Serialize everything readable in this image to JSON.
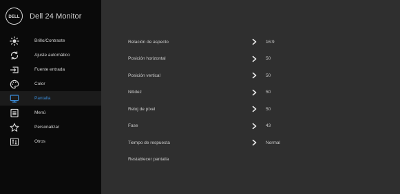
{
  "app": {
    "title": "Dell 24 Monitor",
    "logo_text": "DELL"
  },
  "sidebar": {
    "items": [
      {
        "label": "Brillo/Contraste",
        "icon": "brightness-icon"
      },
      {
        "label": "Ajuste automático",
        "icon": "auto-adjust-icon"
      },
      {
        "label": "Fuente entrada",
        "icon": "input-source-icon"
      },
      {
        "label": "Color",
        "icon": "color-palette-icon"
      },
      {
        "label": "Pantalla",
        "icon": "display-icon",
        "selected": true
      },
      {
        "label": "Menú",
        "icon": "menu-icon"
      },
      {
        "label": "Personalizar",
        "icon": "star-icon"
      },
      {
        "label": "Otros",
        "icon": "info-icon"
      }
    ]
  },
  "display": {
    "rows": [
      {
        "label": "Relación de aspecto",
        "value": "16:9"
      },
      {
        "label": "Posición horizontal",
        "value": "50"
      },
      {
        "label": "Posición vertical",
        "value": "50"
      },
      {
        "label": "Nitidez",
        "value": "50"
      },
      {
        "label": "Reloj de píxel",
        "value": "50"
      },
      {
        "label": "Fase",
        "value": "43"
      },
      {
        "label": "Tiempo de respuesta",
        "value": "Normal"
      },
      {
        "label": "Restablecer pantalla",
        "value": ""
      }
    ]
  },
  "colors": {
    "accent": "#3b8bd5",
    "sidebar_bg": "#0a0a0a",
    "panel_bg": "#2f2f2f",
    "text": "#d4d4d4"
  }
}
